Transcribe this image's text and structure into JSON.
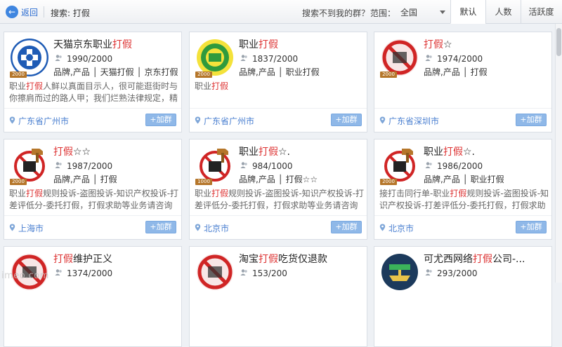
{
  "topbar": {
    "back_label": "返回",
    "search_text": "搜索: 打假",
    "not_found_link": "搜索不到我的群？",
    "scope_label": "范围：",
    "scope_value": "全国",
    "tabs": [
      "默认",
      "人数",
      "活跃度"
    ]
  },
  "keyword": "打假",
  "join_label": "+加群",
  "cards": [
    {
      "title_pre": "天猫京东职业",
      "title_kw": "打假",
      "title_post": "",
      "count": "1990/2000",
      "tags": "品牌,产品 │ 天猫打假 │ 京东打假 │ ...",
      "desc_pre": "职业",
      "desc_kw": "打假",
      "desc_post": "人鲜以真面目示人，很可能逛街时与你擦肩而过的路人甲；我们烂熟法律规定，精与素赔...",
      "location": "广东省广州市",
      "logo": "ring-blue",
      "badge": "2000"
    },
    {
      "title_pre": "职业",
      "title_kw": "打假",
      "title_post": "",
      "count": "1837/2000",
      "tags": "品牌,产品 │ 职业打假",
      "desc_pre": "职业",
      "desc_kw": "打假",
      "desc_post": "",
      "location": "广东省广州市",
      "logo": "green-315",
      "badge": "2000"
    },
    {
      "title_pre": "",
      "title_kw": "打假",
      "title_post": "☆",
      "count": "1974/2000",
      "tags": "品牌,产品 │ 打假",
      "desc_pre": "",
      "desc_kw": "",
      "desc_post": "",
      "location": "广东省深圳市",
      "logo": "fake-red",
      "badge": "2000"
    },
    {
      "title_pre": "",
      "title_kw": "打假",
      "title_post": "☆☆",
      "count": "1987/2000",
      "tags": "品牌,产品 │ 打假",
      "desc_pre": "职业",
      "desc_kw": "打假",
      "desc_post": "规则投诉-盗图投诉-知识产权投诉-打差评低分-委托打假，打假求助等业务请咨询颠瑞群主...",
      "location": "上海市",
      "logo": "fake-hammer",
      "badge": "2000"
    },
    {
      "title_pre": "职业",
      "title_kw": "打假",
      "title_post": "☆.",
      "count": "984/1000",
      "tags": "品牌,产品 │ 打假☆☆",
      "desc_pre": "职业",
      "desc_kw": "打假",
      "desc_post": "规则投诉-盗图投诉-知识产权投诉-打差评低分-委托打假，打假求助等业务请咨询",
      "location": "北京市",
      "logo": "fake-hammer",
      "badge": "1000"
    },
    {
      "title_pre": "职业",
      "title_kw": "打假",
      "title_post": "☆.",
      "count": "1986/2000",
      "tags": "品牌,产品 │ 职业打假",
      "desc_pre": "接打击同行单-职业",
      "desc_kw": "打假",
      "desc_post": "规则投诉-盗图投诉-知识产权投诉-打差评低分-委托打假，打假求助等业务...",
      "location": "北京市",
      "logo": "fake-hammer",
      "badge": "2000"
    },
    {
      "title_pre": "",
      "title_kw": "打假",
      "title_post": "维护正义",
      "count": "1374/2000",
      "tags": "",
      "desc_pre": "",
      "desc_kw": "",
      "desc_post": "",
      "location": "",
      "logo": "fake-red",
      "badge": ""
    },
    {
      "title_pre": "淘宝",
      "title_kw": "打假",
      "title_post": "吃货仅退款",
      "count": "153/200",
      "tags": "",
      "desc_pre": "",
      "desc_kw": "",
      "desc_post": "",
      "location": "",
      "logo": "fake-red",
      "badge": ""
    },
    {
      "title_pre": "可尤西网络",
      "title_kw": "打假",
      "title_post": "公司-...",
      "count": "293/2000",
      "tags": "",
      "desc_pre": "",
      "desc_kw": "",
      "desc_post": "",
      "location": "",
      "logo": "ship",
      "badge": ""
    }
  ],
  "watermark": "imeo.com"
}
